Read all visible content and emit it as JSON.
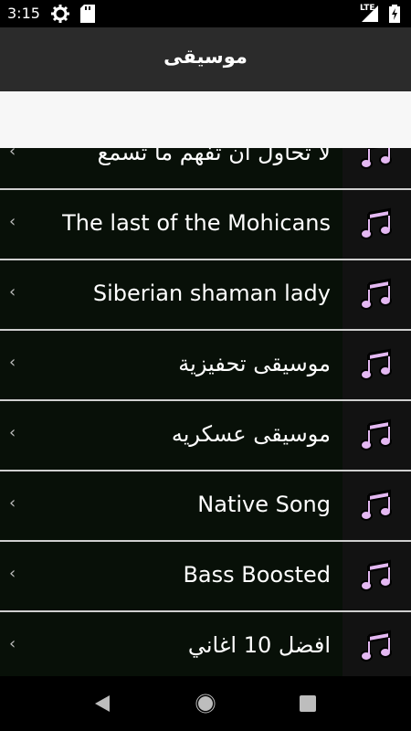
{
  "status_bar": {
    "time": "3:15",
    "network_label": "LTE",
    "icons": [
      "settings-icon",
      "sd-card-icon",
      "signal-icon",
      "battery-charging-icon"
    ]
  },
  "app_bar": {
    "title": "موسيقى"
  },
  "search": {
    "value": "",
    "placeholder": ""
  },
  "list": {
    "items": [
      {
        "label": "لا تحاول ان تفهم ما تسمع",
        "icon": "music-note-icon"
      },
      {
        "label": "The last of the Mohicans",
        "icon": "music-note-icon"
      },
      {
        "label": "Siberian shaman lady",
        "icon": "music-note-icon"
      },
      {
        "label": "موسيقى تحفيزية",
        "icon": "music-note-icon"
      },
      {
        "label": "موسيقى عسكريه",
        "icon": "music-note-icon"
      },
      {
        "label": "Native Song",
        "icon": "music-note-icon"
      },
      {
        "label": "Bass Boosted",
        "icon": "music-note-icon"
      },
      {
        "label": "افضل 10 اغاني",
        "icon": "music-note-icon"
      }
    ]
  },
  "nav_bar": {
    "buttons": [
      "back-icon",
      "home-icon",
      "recents-icon"
    ]
  },
  "colors": {
    "app_bar": "#2b2b2b",
    "row_background": "#081008",
    "icon_background": "#121212",
    "divider": "#cfcfcf",
    "note_fill": "#e4b8f2"
  }
}
